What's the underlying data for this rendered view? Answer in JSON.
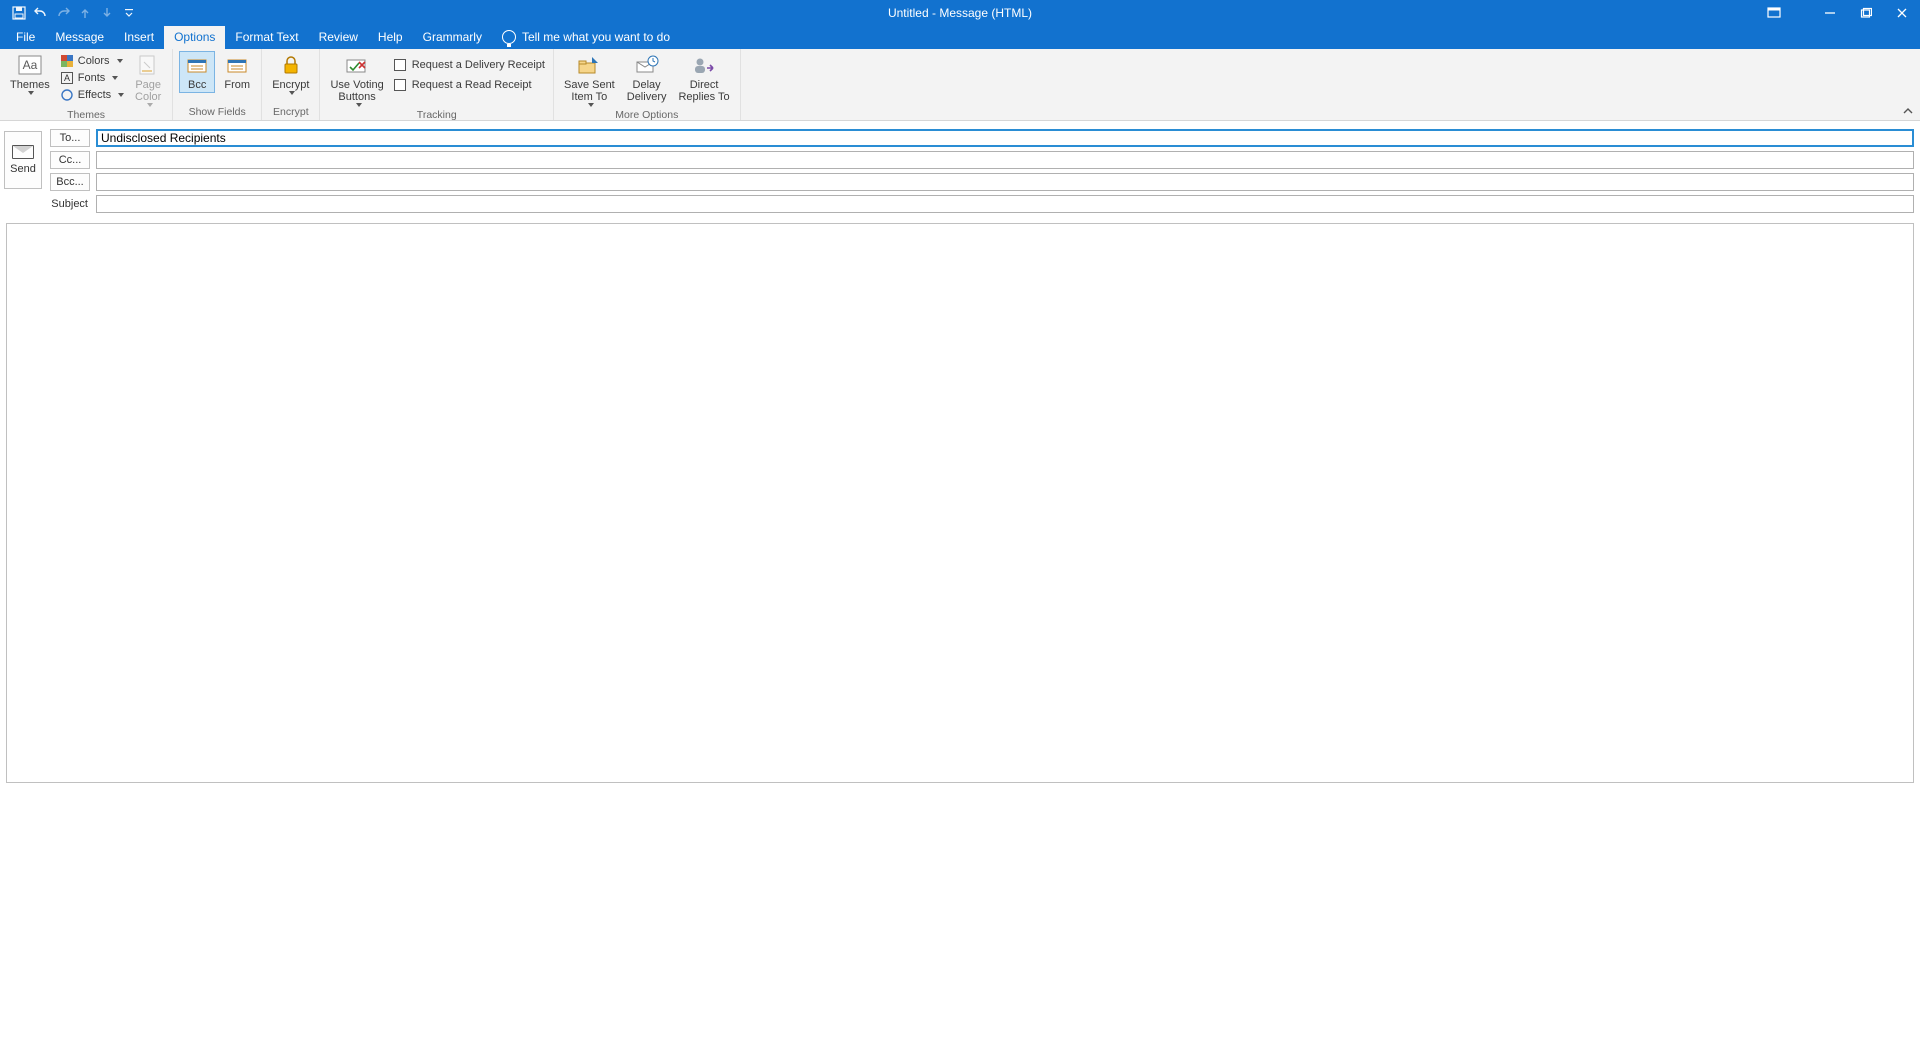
{
  "window": {
    "title": "Untitled  -  Message (HTML)"
  },
  "qat": {
    "save": "save",
    "undo": "undo",
    "redo": "redo",
    "prev": "prev",
    "next": "next",
    "customize": "customize"
  },
  "tabs": {
    "file": "File",
    "message": "Message",
    "insert": "Insert",
    "options": "Options",
    "format_text": "Format Text",
    "review": "Review",
    "help": "Help",
    "grammarly": "Grammarly",
    "tell_me": "Tell me what you want to do",
    "active": "options"
  },
  "ribbon": {
    "themes": {
      "label": "Themes",
      "themes_btn": "Themes",
      "colors": "Colors",
      "fonts": "Fonts",
      "effects": "Effects",
      "page_color": "Page\nColor"
    },
    "show_fields": {
      "label": "Show Fields",
      "bcc": "Bcc",
      "from": "From",
      "bcc_pressed": true,
      "from_pressed": false
    },
    "encrypt": {
      "label": "Encrypt",
      "encrypt_btn": "Encrypt"
    },
    "tracking": {
      "label": "Tracking",
      "voting": "Use Voting\nButtons",
      "req_delivery": "Request a Delivery Receipt",
      "req_read": "Request a Read Receipt"
    },
    "more_options": {
      "label": "More Options",
      "save_sent": "Save Sent\nItem To",
      "delay": "Delay\nDelivery",
      "direct": "Direct\nReplies To"
    }
  },
  "header": {
    "send": "Send",
    "to_btn": "To...",
    "cc_btn": "Cc...",
    "bcc_btn": "Bcc...",
    "subject_label": "Subject",
    "to_value": "Undisclosed Recipients",
    "cc_value": "",
    "bcc_value": "",
    "subject_value": ""
  },
  "body": {
    "content": ""
  }
}
